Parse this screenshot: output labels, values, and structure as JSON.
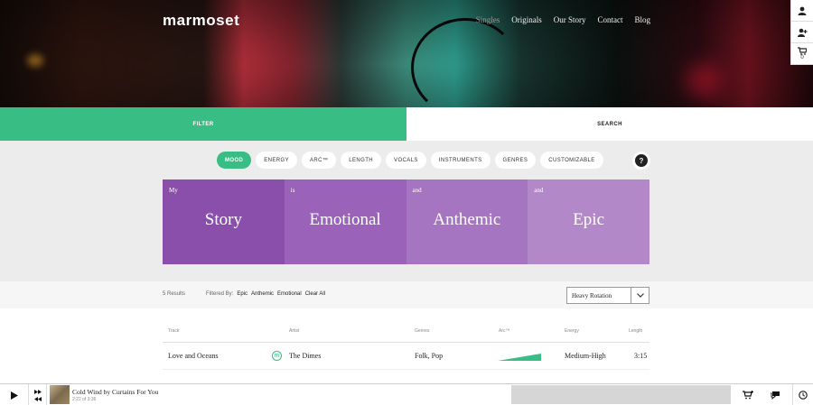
{
  "header": {
    "logo": "marmoset",
    "nav": [
      {
        "label": "Singles",
        "muted": true
      },
      {
        "label": "Originals"
      },
      {
        "label": "Our Story"
      },
      {
        "label": "Contact"
      },
      {
        "label": "Blog"
      }
    ]
  },
  "side_tools": {
    "cart_count": "0"
  },
  "tabs": {
    "filter": "FILTER",
    "search": "SEARCH"
  },
  "pills": [
    {
      "label": "MOOD",
      "active": true
    },
    {
      "label": "ENERGY"
    },
    {
      "label": "ARC™"
    },
    {
      "label": "LENGTH"
    },
    {
      "label": "VOCALS"
    },
    {
      "label": "INSTRUMENTS"
    },
    {
      "label": "GENRES"
    },
    {
      "label": "CUSTOMIZABLE"
    }
  ],
  "help": "?",
  "tiles": [
    {
      "pre": "My",
      "word": "Story",
      "color": "#8a4fab"
    },
    {
      "pre": "is",
      "word": "Emotional",
      "color": "#9a63b9"
    },
    {
      "pre": "and",
      "word": "Anthemic",
      "color": "#a675c1"
    },
    {
      "pre": "and",
      "word": "Epic",
      "color": "#b288c9"
    }
  ],
  "results": {
    "count": "5 Results",
    "filtered_label": "Filtered By:",
    "tags": [
      "Epic",
      "Anthemic",
      "Emotional"
    ],
    "clear": "Clear All",
    "sort_value": "Heavy Rotation"
  },
  "table": {
    "headers": {
      "track": "Track",
      "artist": "Artist",
      "genres": "Genres",
      "arc": "Arc™",
      "energy": "Energy",
      "length": "Length"
    },
    "rows": [
      {
        "track": "Love and Oceans",
        "badge": "m",
        "artist": "The Dimes",
        "genres": "Folk, Pop",
        "energy": "Medium-High",
        "length": "3:15"
      }
    ]
  },
  "player": {
    "title": "Cold Wind by Curtains For You",
    "time": "2:22 of 3:36",
    "progress": 0.0
  },
  "colors": {
    "accent": "#38bd85"
  }
}
